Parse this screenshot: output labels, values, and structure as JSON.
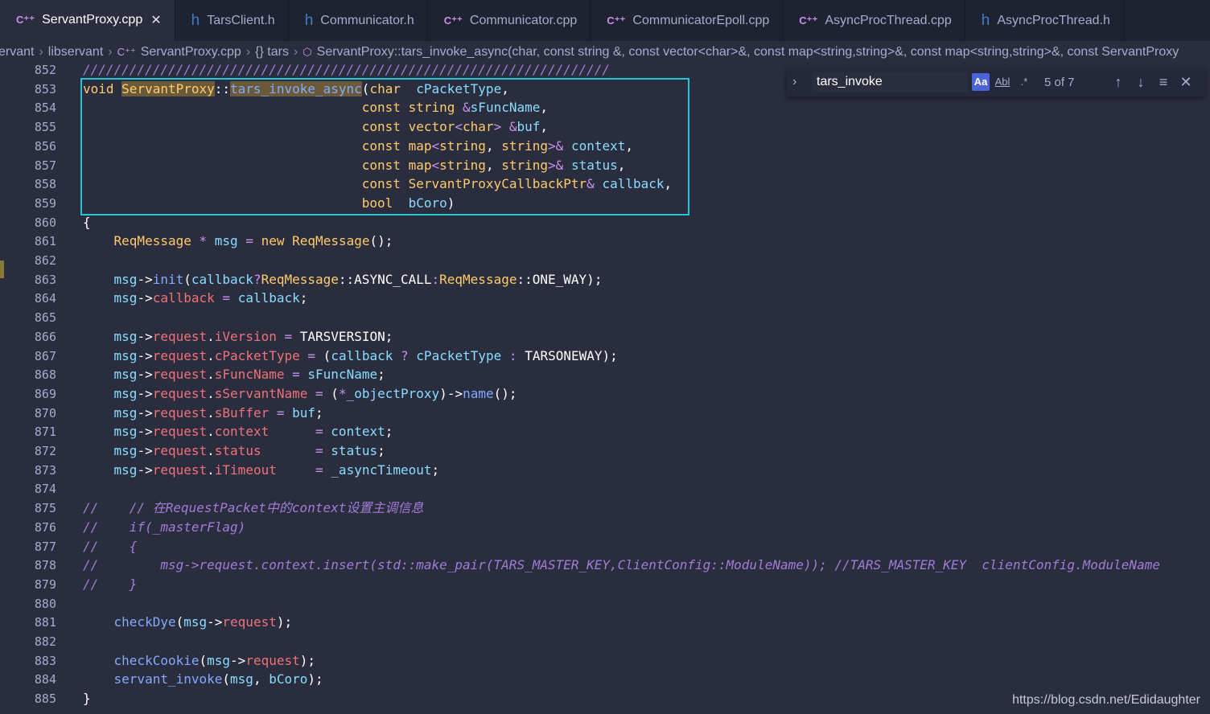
{
  "tabs": [
    {
      "label": "ServantProxy.cpp",
      "type": "cpp",
      "active": true,
      "icon": "cpp-file-icon"
    },
    {
      "label": "TarsClient.h",
      "type": "h",
      "active": false,
      "icon": "h-file-icon"
    },
    {
      "label": "Communicator.h",
      "type": "h",
      "active": false,
      "icon": "h-file-icon"
    },
    {
      "label": "Communicator.cpp",
      "type": "cpp",
      "active": false,
      "icon": "cpp-file-icon"
    },
    {
      "label": "CommunicatorEpoll.cpp",
      "type": "cpp",
      "active": false,
      "icon": "cpp-file-icon"
    },
    {
      "label": "AsyncProcThread.cpp",
      "type": "cpp",
      "active": false,
      "icon": "cpp-file-icon"
    },
    {
      "label": "AsyncProcThread.h",
      "type": "h",
      "active": false,
      "icon": "h-file-icon"
    }
  ],
  "breadcrumb": {
    "parts": [
      "ervant",
      "libservant",
      "ServantProxy.cpp",
      "{} tars",
      "ServantProxy::tars_invoke_async(char, const string &, const vector<char>&, const map<string,string>&, const map<string,string>&, const ServantProxy"
    ]
  },
  "find": {
    "query": "tars_invoke",
    "match_case_label": "Aa",
    "whole_word_label": "Abl",
    "regex_label": ".*",
    "count": "5 of 7"
  },
  "line_numbers": [
    "852",
    "853",
    "854",
    "855",
    "856",
    "857",
    "858",
    "859",
    "860",
    "861",
    "862",
    "863",
    "864",
    "865",
    "866",
    "867",
    "868",
    "869",
    "870",
    "871",
    "872",
    "873",
    "874",
    "875",
    "876",
    "877",
    "878",
    "879",
    "880",
    "881",
    "882",
    "883",
    "884",
    "885"
  ],
  "code": [
    "////////////////////////////////////////////////////////////////////",
    "void ServantProxy::tars_invoke_async(char  cPacketType,",
    "                                    const string &sFuncName,",
    "                                    const vector<char> &buf,",
    "                                    const map<string, string>& context,",
    "                                    const map<string, string>& status,",
    "                                    const ServantProxyCallbackPtr& callback,",
    "                                    bool  bCoro)",
    "{",
    "    ReqMessage * msg = new ReqMessage();",
    "",
    "    msg->init(callback?ReqMessage::ASYNC_CALL:ReqMessage::ONE_WAY);",
    "    msg->callback = callback;",
    "",
    "    msg->request.iVersion = TARSVERSION;",
    "    msg->request.cPacketType = (callback ? cPacketType : TARSONEWAY);",
    "    msg->request.sFuncName = sFuncName;",
    "    msg->request.sServantName = (*_objectProxy)->name();",
    "    msg->request.sBuffer = buf;",
    "    msg->request.context      = context;",
    "    msg->request.status       = status;",
    "    msg->request.iTimeout     = _asyncTimeout;",
    "",
    "//    // 在RequestPacket中的context设置主调信息",
    "//    if(_masterFlag)",
    "//    {",
    "//        msg->request.context.insert(std::make_pair(TARS_MASTER_KEY,ClientConfig::ModuleName)); //TARS_MASTER_KEY  clientConfig.ModuleName",
    "//    }",
    "",
    "    checkDye(msg->request);",
    "",
    "    checkCookie(msg->request);",
    "    servant_invoke(msg, bCoro);",
    "}"
  ],
  "watermark": "https://blog.csdn.net/Edidaughter",
  "colors": {
    "background": "#292d3e",
    "keyword": "#ffcb6b",
    "function": "#82aaff",
    "operator": "#c792ea",
    "comment": "#a17cd6",
    "highlight_box": "#22c7d6"
  }
}
